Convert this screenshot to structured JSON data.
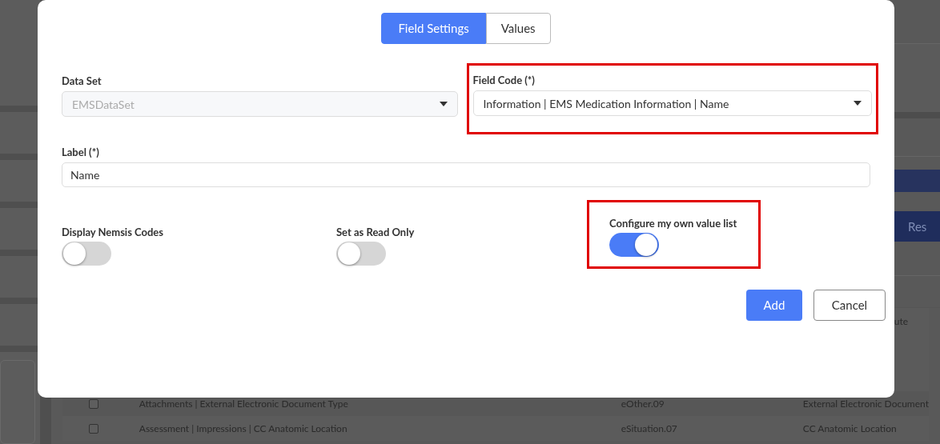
{
  "background": {
    "reset_button": {
      "label": "Res"
    },
    "rows": [
      {
        "column_3": "ute"
      },
      {
        "checked": false,
        "name": "Attachments | External Electronic Document Type",
        "code": "eOther.09",
        "column_3": "External Electronic Document"
      },
      {
        "checked": false,
        "name": "Assessment | Impressions | CC Anatomic Location",
        "code": "eSituation.07",
        "column_3": "CC Anatomic Location"
      }
    ]
  },
  "dialog": {
    "tabs": [
      {
        "label": "Field Settings",
        "selected": true
      },
      {
        "label": "Values",
        "selected": false
      }
    ],
    "data_set": {
      "label": "Data Set",
      "value": "EMSDataSet",
      "disabled": true,
      "highlighted": false
    },
    "field_code": {
      "label": "Field Code (*)",
      "value": "Information | EMS Medication Information | Name",
      "disabled": false,
      "highlighted": true
    },
    "label_field": {
      "label": "Label (*)",
      "value": "Name"
    },
    "toggles": [
      {
        "label": "Display Nemsis Codes",
        "on": false,
        "highlighted": false
      },
      {
        "label": "Set as Read Only",
        "on": false,
        "highlighted": false
      },
      {
        "label": "Configure my own value list",
        "on": true,
        "highlighted": true
      }
    ],
    "buttons": [
      {
        "label": "Add",
        "kind": "primary"
      },
      {
        "label": "Cancel",
        "kind": "secondary"
      }
    ]
  }
}
